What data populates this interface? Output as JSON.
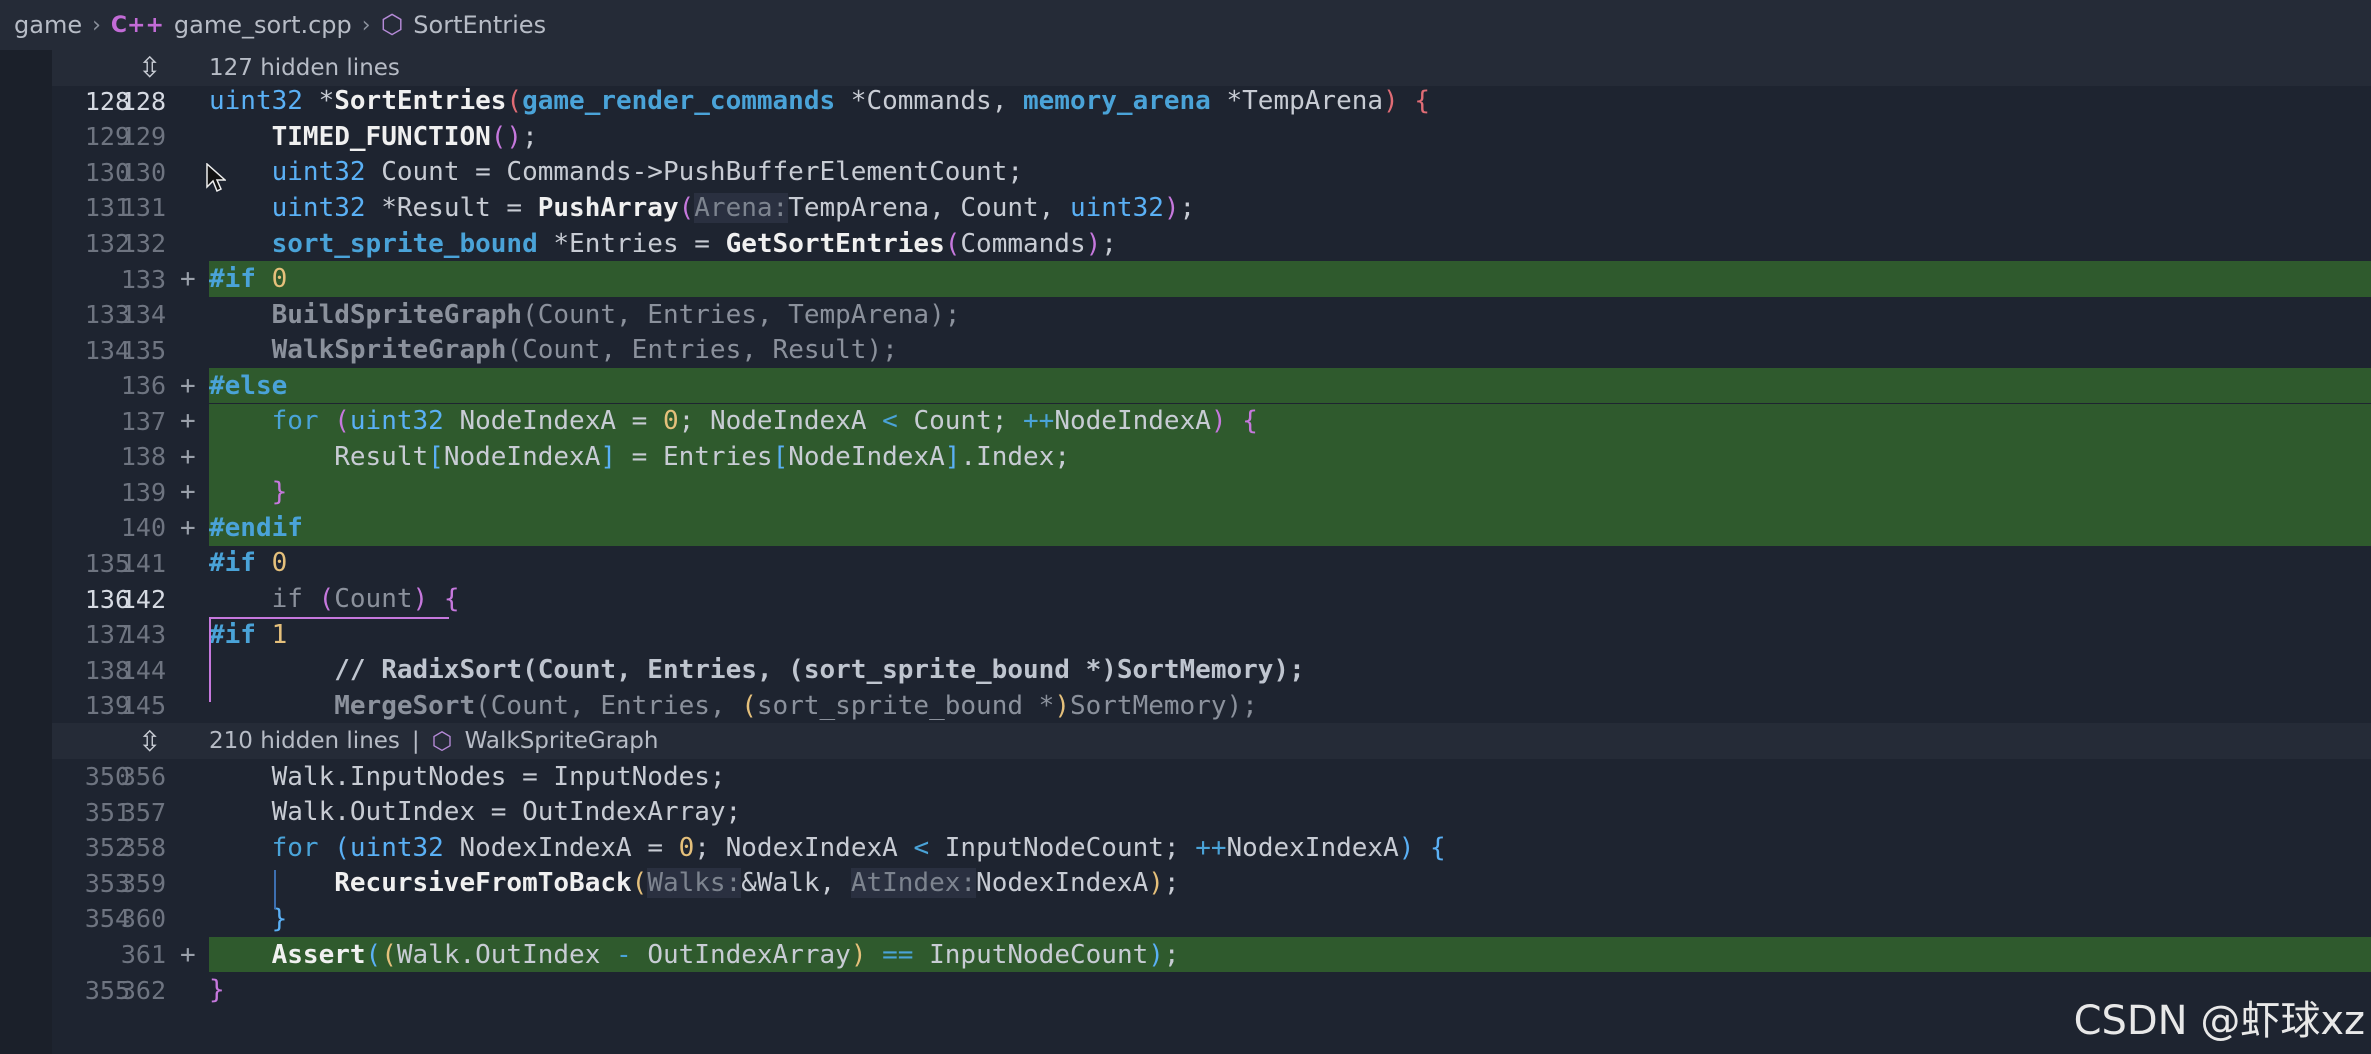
{
  "breadcrumb": {
    "folder": "game",
    "file": "game_sort.cpp",
    "symbol": "SortEntries"
  },
  "fold_top": {
    "text": "127 hidden lines"
  },
  "fold_mid": {
    "text": "210 hidden lines",
    "divider": "|",
    "symbol": "WalkSpriteGraph"
  },
  "rows": [
    {
      "old": "128",
      "new": "128",
      "plus": "",
      "added": false,
      "cur": true
    },
    {
      "old": "129",
      "new": "129",
      "plus": "",
      "added": false
    },
    {
      "old": "130",
      "new": "130",
      "plus": "",
      "added": false
    },
    {
      "old": "131",
      "new": "131",
      "plus": "",
      "added": false
    },
    {
      "old": "132",
      "new": "132",
      "plus": "",
      "added": false
    },
    {
      "old": "",
      "new": "133",
      "plus": "+",
      "added": true
    },
    {
      "old": "133",
      "new": "134",
      "plus": "",
      "added": false
    },
    {
      "old": "134",
      "new": "135",
      "plus": "",
      "added": false
    },
    {
      "old": "",
      "new": "136",
      "plus": "+",
      "added": true
    },
    {
      "old": "",
      "new": "137",
      "plus": "+",
      "added": true
    },
    {
      "old": "",
      "new": "138",
      "plus": "+",
      "added": true
    },
    {
      "old": "",
      "new": "139",
      "plus": "+",
      "added": true
    },
    {
      "old": "",
      "new": "140",
      "plus": "+",
      "added": true
    },
    {
      "old": "135",
      "new": "141",
      "plus": "",
      "added": false
    },
    {
      "old": "136",
      "new": "142",
      "plus": "",
      "added": false,
      "cur": true
    },
    {
      "old": "137",
      "new": "143",
      "plus": "",
      "added": false
    },
    {
      "old": "138",
      "new": "144",
      "plus": "",
      "added": false
    },
    {
      "old": "139",
      "new": "145",
      "plus": "",
      "added": false
    },
    {
      "old": "350",
      "new": "356",
      "plus": "",
      "added": false
    },
    {
      "old": "351",
      "new": "357",
      "plus": "",
      "added": false
    },
    {
      "old": "352",
      "new": "358",
      "plus": "",
      "added": false
    },
    {
      "old": "353",
      "new": "359",
      "plus": "",
      "added": false
    },
    {
      "old": "354",
      "new": "360",
      "plus": "",
      "added": false
    },
    {
      "old": "",
      "new": "361",
      "plus": "+",
      "added": true
    },
    {
      "old": "355",
      "new": "362",
      "plus": "",
      "added": false
    }
  ],
  "code": [
    [
      [
        "t-type",
        "uint32"
      ],
      [
        "t-op",
        " *"
      ],
      [
        "t-fn",
        "SortEntries"
      ],
      [
        "t-br1",
        "("
      ],
      [
        "t-type t-pp",
        "game_render_commands"
      ],
      [
        "t-op",
        " *Commands, "
      ],
      [
        "t-type t-pp",
        "memory_arena"
      ],
      [
        "t-op",
        " *TempArena"
      ],
      [
        "t-br1",
        ")"
      ],
      [
        "t-op",
        " "
      ],
      [
        "t-br1",
        "{"
      ]
    ],
    [
      [
        "t-op",
        "    "
      ],
      [
        "t-fn",
        "TIMED_FUNCTION"
      ],
      [
        "t-br2",
        "()"
      ],
      [
        "t-op",
        ";"
      ]
    ],
    [
      [
        "t-op",
        "    "
      ],
      [
        "t-type",
        "uint32"
      ],
      [
        "t-op",
        " Count = Commands->PushBufferElementCount;"
      ]
    ],
    [
      [
        "t-op",
        "    "
      ],
      [
        "t-type",
        "uint32"
      ],
      [
        "t-op",
        " *Result = "
      ],
      [
        "t-fn",
        "PushArray"
      ],
      [
        "t-br2",
        "("
      ],
      [
        "t-hint",
        "Arena:"
      ],
      [
        "t-op",
        "TempArena, Count, "
      ],
      [
        "t-type",
        "uint32"
      ],
      [
        "t-br2",
        ")"
      ],
      [
        "t-op",
        ";"
      ]
    ],
    [
      [
        "t-op",
        "    "
      ],
      [
        "t-type t-pp",
        "sort_sprite_bound"
      ],
      [
        "t-op",
        " *Entries = "
      ],
      [
        "t-fn",
        "GetSortEntries"
      ],
      [
        "t-br2",
        "("
      ],
      [
        "t-op",
        "Commands"
      ],
      [
        "t-br2",
        ")"
      ],
      [
        "t-op",
        ";"
      ]
    ],
    [
      [
        "t-pp",
        "#if"
      ],
      [
        "t-op",
        " "
      ],
      [
        "t-num",
        "0"
      ]
    ],
    [
      [
        "t-op",
        "    "
      ],
      [
        "t-fn t-dim",
        "BuildSpriteGraph"
      ],
      [
        "t-dim",
        "(Count, Entries, TempArena);"
      ]
    ],
    [
      [
        "t-op",
        "    "
      ],
      [
        "t-fn t-dim",
        "WalkSpriteGraph"
      ],
      [
        "t-dim",
        "(Count, Entries, Result);"
      ]
    ],
    [
      [
        "t-pp",
        "#else"
      ]
    ],
    [
      [
        "t-op",
        "    "
      ],
      [
        "t-kw",
        "for"
      ],
      [
        "t-op",
        " "
      ],
      [
        "t-br2",
        "("
      ],
      [
        "t-type",
        "uint32"
      ],
      [
        "t-op",
        " NodeIndexA = "
      ],
      [
        "t-num",
        "0"
      ],
      [
        "t-op",
        "; NodeIndexA "
      ],
      [
        "t-kw",
        "<"
      ],
      [
        "t-op",
        " Count; "
      ],
      [
        "t-kw",
        "++"
      ],
      [
        "t-op",
        "NodeIndexA"
      ],
      [
        "t-br2",
        ")"
      ],
      [
        "t-op",
        " "
      ],
      [
        "t-br2",
        "{"
      ]
    ],
    [
      [
        "t-op",
        "        Result"
      ],
      [
        "t-br3",
        "["
      ],
      [
        "t-op",
        "NodeIndexA"
      ],
      [
        "t-br3",
        "]"
      ],
      [
        "t-op",
        " = Entries"
      ],
      [
        "t-br3",
        "["
      ],
      [
        "t-op",
        "NodeIndexA"
      ],
      [
        "t-br3",
        "]"
      ],
      [
        "t-op",
        ".Index;"
      ]
    ],
    [
      [
        "t-op",
        "    "
      ],
      [
        "t-br2",
        "}"
      ]
    ],
    [
      [
        "t-pp",
        "#endif"
      ]
    ],
    [
      [
        "t-pp",
        "#if"
      ],
      [
        "t-op",
        " "
      ],
      [
        "t-num",
        "0"
      ]
    ],
    [
      [
        "t-op",
        "    "
      ],
      [
        "t-kw t-dim",
        "if"
      ],
      [
        "t-dim",
        " "
      ],
      [
        "t-br2",
        "("
      ],
      [
        "t-dim",
        "Count"
      ],
      [
        "t-br2",
        ")"
      ],
      [
        "t-dim",
        " "
      ],
      [
        "t-br2",
        "{"
      ]
    ],
    [
      [
        "t-pp t-dim",
        "#if"
      ],
      [
        "t-dim",
        " "
      ],
      [
        "t-num",
        "1"
      ]
    ],
    [
      [
        "t-op",
        "        "
      ],
      [
        "t-comment",
        "// RadixSort(Count, Entries, (sort_sprite_bound *)SortMemory);"
      ]
    ],
    [
      [
        "t-op",
        "        "
      ],
      [
        "t-fn t-dim",
        "MergeSort"
      ],
      [
        "t-dim",
        "(Count, Entries, "
      ],
      [
        "t-br4",
        "("
      ],
      [
        "t-dim",
        "sort_sprite_bound *"
      ],
      [
        "t-br4",
        ")"
      ],
      [
        "t-dim",
        "SortMemory);"
      ]
    ],
    [
      [
        "t-op",
        "    Walk.InputNodes = InputNodes;"
      ]
    ],
    [
      [
        "t-op",
        "    Walk.OutIndex = OutIndexArray;"
      ]
    ],
    [
      [
        "t-op",
        "    "
      ],
      [
        "t-kw",
        "for"
      ],
      [
        "t-op",
        " "
      ],
      [
        "t-br3",
        "("
      ],
      [
        "t-type",
        "uint32"
      ],
      [
        "t-op",
        " NodexIndexA = "
      ],
      [
        "t-num",
        "0"
      ],
      [
        "t-op",
        "; NodexIndexA "
      ],
      [
        "t-kw",
        "<"
      ],
      [
        "t-op",
        " InputNodeCount; "
      ],
      [
        "t-kw",
        "++"
      ],
      [
        "t-op",
        "NodexIndexA"
      ],
      [
        "t-br3",
        ")"
      ],
      [
        "t-op",
        " "
      ],
      [
        "t-br3",
        "{"
      ]
    ],
    [
      [
        "t-op",
        "        "
      ],
      [
        "t-fn",
        "RecursiveFromToBack"
      ],
      [
        "t-br4",
        "("
      ],
      [
        "t-hint",
        "Walks:"
      ],
      [
        "t-op",
        "&Walk, "
      ],
      [
        "t-hint",
        "AtIndex:"
      ],
      [
        "t-op",
        "NodexIndexA"
      ],
      [
        "t-br4",
        ")"
      ],
      [
        "t-op",
        ";"
      ]
    ],
    [
      [
        "t-op",
        "    "
      ],
      [
        "t-br3",
        "}"
      ]
    ],
    [
      [
        "t-op",
        "    "
      ],
      [
        "t-fn",
        "Assert"
      ],
      [
        "t-br3",
        "("
      ],
      [
        "t-br4",
        "("
      ],
      [
        "t-op",
        "Walk.OutIndex "
      ],
      [
        "t-kw",
        "-"
      ],
      [
        "t-op",
        " OutIndexArray"
      ],
      [
        "t-br4",
        ")"
      ],
      [
        "t-op",
        " "
      ],
      [
        "t-kw",
        "=="
      ],
      [
        "t-op",
        " InputNodeCount"
      ],
      [
        "t-br3",
        ")"
      ],
      [
        "t-op",
        ";"
      ]
    ],
    [
      [
        "t-br2",
        "}"
      ]
    ]
  ],
  "watermark": "CSDN @虾球xz",
  "colors": {
    "added_bg": "#2f5a2d",
    "background": "#1e2430",
    "accent": "#5ab0f5"
  }
}
